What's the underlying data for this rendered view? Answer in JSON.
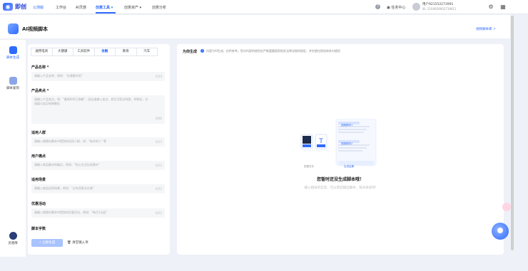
{
  "topbar": {
    "logo_text": "即创",
    "badge": "公测版",
    "nav": [
      "工作台",
      "AI灵感",
      "创意工具 ▾",
      "创意资产 ▾",
      "创意分析"
    ],
    "task_center": "任务中心",
    "user_name": "用户921552273991",
    "user_id": "ID: 2104929002719611"
  },
  "subbar": {
    "title": "AI视频脚本",
    "link": "视频脚本库"
  },
  "leftnav": {
    "items": [
      {
        "label": "脚本生成",
        "icon": "script-generate-icon"
      },
      {
        "label": "脚本复刻",
        "icon": "script-replicate-icon"
      },
      {
        "label": "灵感库",
        "icon": "inspiration-icon"
      }
    ]
  },
  "form": {
    "tabs": [
      "通用电商",
      "大健康",
      "工具软件",
      "金融",
      "教育",
      "汽车"
    ],
    "active_tab": "金融",
    "fields": [
      {
        "label": "产品名称 *",
        "placeholder": "请输入产品名称，例如：\"交通意外险\"",
        "count": "0/20"
      },
      {
        "label": "产品卖点 *",
        "placeholder": "请输入产品卖点，如：\"最高600万保额\"，因长度输入卖点，如生活家点阵图，特殊化，分段展示卖点效果最佳",
        "count": "0/66"
      },
      {
        "label": "适用人群",
        "placeholder": "请输入期望在脚本中提到的适用人群，如：\"有车的人\" 等",
        "count": "0/15"
      },
      {
        "label": "用户痛点",
        "placeholder": "请输入商品解决的痛点，例如：\"担心生活出现意外\"",
        "count": "0/22"
      },
      {
        "label": "适用场景",
        "placeholder": "请输入商品适用场景，例如：\"过年回家长礼物\"",
        "count": "0/22"
      },
      {
        "label": "优惠活动",
        "placeholder": "请输入期望在脚本中提到的优惠活动，例如：\"每月1元起\"",
        "count": "0/22"
      },
      {
        "label": "脚本字数",
        "placeholder": "",
        "count": ""
      }
    ],
    "generate_button": "⚡ 立即生成",
    "clear_button": "清空输入项"
  },
  "output": {
    "title": "为你生成",
    "note": "内容为AI生成，仅供参考。您对内容的使用应严格遵循国家相关法律法规的规定，并仅限在即创体系内使用",
    "card_top": "视频脚本1",
    "card_bottom": "视频脚本2",
    "step_left": "配置任务",
    "step_right": "生成结果",
    "empty_title": "您暂时还没生成脚本哦！",
    "empty_sub": "输入相关的信息，可以帮您输出脚本，快去体验吧!"
  }
}
